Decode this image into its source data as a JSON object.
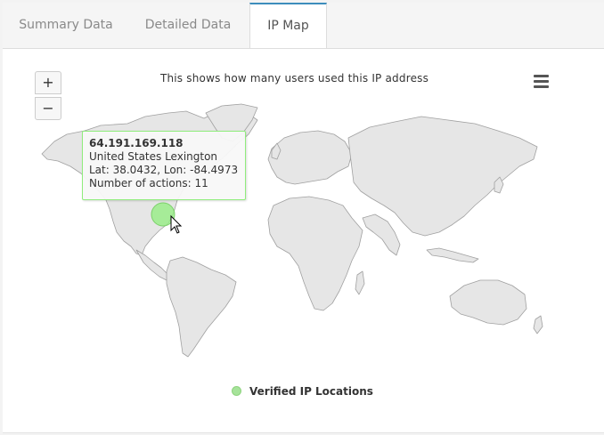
{
  "tabs": [
    {
      "label": "Summary Data",
      "active": false
    },
    {
      "label": "Detailed Data",
      "active": false
    },
    {
      "label": "IP Map",
      "active": true
    }
  ],
  "map": {
    "title": "This shows how many users used this IP address",
    "zoom_in": "+",
    "zoom_out": "−",
    "menu_icon": "hamburger-menu-icon"
  },
  "tooltip": {
    "ip": "64.191.169.118",
    "location": "United States Lexington",
    "coords": "Lat: 38.0432, Lon: -84.4973",
    "actions": "Number of actions: 11"
  },
  "legend": {
    "label": "Verified IP Locations"
  },
  "colors": {
    "accent": "#3c8dbc",
    "point": "#90ed7d",
    "land": "#e6e6e6",
    "land_stroke": "#a0a0a0"
  }
}
